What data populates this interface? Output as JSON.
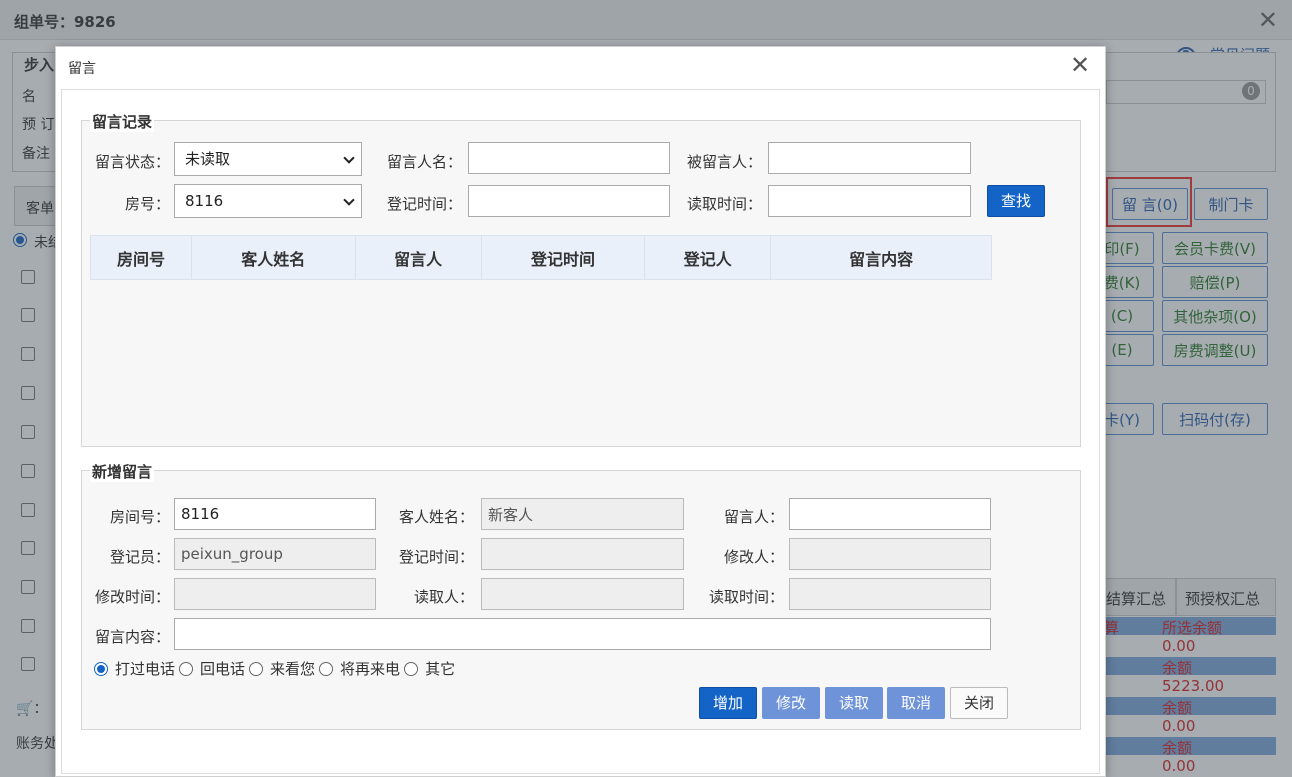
{
  "background": {
    "window_title": "组单号：9826",
    "help_label": "常见问题",
    "section_title_partial": "步入",
    "labels": [
      "名",
      "预 订",
      "备注"
    ],
    "badge_count": "0",
    "tab_partial": "客单",
    "radio_partial": "未结",
    "buttons": [
      {
        "label": "留 言(0)",
        "style": "blue"
      },
      {
        "label": "制门卡",
        "style": "blue"
      },
      {
        "label": "印(F)",
        "style": "green"
      },
      {
        "label": "会员卡费(V)",
        "style": "green"
      },
      {
        "label": "费(K)",
        "style": "green"
      },
      {
        "label": "赔偿(P)",
        "style": "green"
      },
      {
        "label": "(C)",
        "style": "green"
      },
      {
        "label": "其他杂项(O)",
        "style": "green"
      },
      {
        "label": "(E)",
        "style": "green"
      },
      {
        "label": "房费调整(U)",
        "style": "green"
      },
      {
        "label": "卡(Y)",
        "style": "blue"
      },
      {
        "label": "扫码付(存)",
        "style": "blue"
      }
    ],
    "summary_tabs": [
      "结算汇总",
      "预授权汇总"
    ],
    "summary_rows": [
      {
        "left": "算",
        "right": "所选余额"
      },
      {
        "left": "",
        "right": "0.00"
      },
      {
        "left": "",
        "right": "余额"
      },
      {
        "left": "",
        "right": "5223.00"
      },
      {
        "left": "",
        "right": "余额"
      },
      {
        "left": "",
        "right": "0.00"
      },
      {
        "left": "",
        "right": "余额"
      },
      {
        "left": "",
        "right": "0.00"
      }
    ],
    "bottom_label": "账务处",
    "bottom_icon_label": "："
  },
  "dialog": {
    "title": "留言",
    "records": {
      "legend": "留言记录",
      "status_label": "留言状态：",
      "status_value": "未读取",
      "author_label": "留言人名：",
      "author_value": "",
      "recipient_label": "被留言人：",
      "recipient_value": "",
      "room_label": "房号：",
      "room_value": "8116",
      "reg_time_label": "登记时间：",
      "reg_time_value": "",
      "read_time_label": "读取时间：",
      "read_time_value": "",
      "search_button": "查找",
      "columns": [
        "房间号",
        "客人姓名",
        "留言人",
        "登记时间",
        "登记人",
        "留言内容"
      ]
    },
    "new_message": {
      "legend": "新增留言",
      "room_label": "房间号：",
      "room_value": "8116",
      "guest_label": "客人姓名：",
      "guest_value": "新客人",
      "author_label": "留言人：",
      "author_value": "",
      "registrar_label": "登记员：",
      "registrar_value": "peixun_group",
      "reg_time_label": "登记时间：",
      "reg_time_value": "",
      "modifier_label": "修改人：",
      "modifier_value": "",
      "mod_time_label": "修改时间：",
      "mod_time_value": "",
      "reader_label": "读取人：",
      "reader_value": "",
      "read_time_label": "读取时间：",
      "read_time_value": "",
      "content_label": "留言内容：",
      "content_value": "",
      "radio_options": [
        "打过电话",
        "回电话",
        "来看您",
        "将再来电",
        "其它"
      ],
      "selected_option": "打过电话",
      "buttons": {
        "add": "增加",
        "edit": "修改",
        "read": "读取",
        "cancel": "取消",
        "close": "关闭"
      }
    }
  }
}
